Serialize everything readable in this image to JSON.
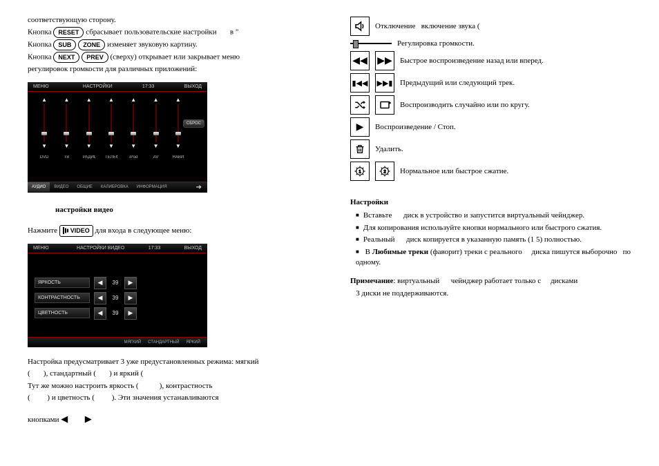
{
  "left": {
    "line1": "соответствующую сторону.",
    "line2_a": "Кнопка",
    "btn_reset": "RESET",
    "line2_b": "сбрасывает пользовательские настройки",
    "line2_c": "в \"",
    "line3_a": "Кнопка",
    "btn_sub": "SUB",
    "btn_zone": "ZONE",
    "line3_b": "изменяет звуковую картину.",
    "line4_a": "Кнопка",
    "btn_next": "NEXT",
    "btn_prev": "PREV",
    "line4_b": "(сверху) открывает или закрывает меню",
    "line5": "регулировок громкости для различных приложений:",
    "screen1": {
      "menu": "МЕНЮ",
      "title": "НАСТРОЙКИ",
      "time": "17:33",
      "exit": "ВЫХОД",
      "sliders": [
        "DVD",
        "ТВ",
        "РАДИО",
        "ТЕЛЕФОН",
        "iPod",
        "AV",
        "НАВИ"
      ],
      "value_base": "0",
      "reset_btn": "СБРОС",
      "tabs": [
        "АУДИО",
        "ВИДЕО",
        "ОБЩИЕ",
        "КАЛИБРОВКА",
        "ИНФОРМАЦИЯ"
      ]
    },
    "video_heading": "настройки видео",
    "video_line1_a": "Нажмите",
    "btn_video": "VIDEO",
    "video_line1_b": "для входа в следующее меню:",
    "screen2": {
      "menu": "МЕНЮ",
      "title": "НАСТРОЙКИ ВИДЕО",
      "time": "17:33",
      "exit": "ВЫХОД",
      "rows": [
        {
          "label": "ЯРКОСТЬ",
          "value": "39"
        },
        {
          "label": "КОНТРАСТНОСТЬ",
          "value": "39"
        },
        {
          "label": "ЦВЕТНОСТЬ",
          "value": "39"
        }
      ],
      "modes": [
        "МЯГКИЙ",
        "СТАНДАРТНЫЙ",
        "ЯРКИЙ"
      ]
    },
    "para2_l1": "Настройка предусматривает  3 уже  предустановленных режима: мягкий",
    "para2_l2": "(       ), стандартный (       ) и яркий (",
    "para2_l3": "Тут  же  можно   настроить  яркость   (           ),   контрастность",
    "para2_l4": "(         )  и  цветность  (         ).  Эти  значения  устанавливаются",
    "para3": "кнопками",
    "arrows": "◀  ▶"
  },
  "right": {
    "rows": [
      {
        "icons": [
          "speaker"
        ],
        "text": "Отключение   включение звука ("
      },
      {
        "icons": [
          "vslider"
        ],
        "text": "Регулировка громкости."
      },
      {
        "icons": [
          "rw",
          "ff"
        ],
        "text": "Быстрое воспроизведение назад или вперед."
      },
      {
        "icons": [
          "prev",
          "next"
        ],
        "text": "Предыдущий или следующий трек."
      },
      {
        "icons": [
          "shuffle",
          "repeat"
        ],
        "text": "Воспроизводить случайно или по кругу."
      },
      {
        "icons": [
          "play"
        ],
        "text": "Воспроизведение / Стоп."
      },
      {
        "icons": [
          "trash"
        ],
        "text": "Удалить."
      },
      {
        "icons": [
          "gear1",
          "gear2"
        ],
        "text": "Нормальное или быстрое сжатие."
      }
    ],
    "settings_heading": "Настройки",
    "bullets": {
      "b1": "Вставьте      диск в устройство и запустится виртуальный чейнджер.",
      "b2": "Для копирования используйте кнопки нормального или быстрого сжатия.",
      "b3": "Реальный      диск копируется в указанную память (1 5) полностью.",
      "b4_a": "В ",
      "b4_b": "Любимые треки",
      "b4_c": " (фаворит) треки с реального     диска пишутся выборочно   по одному."
    },
    "note_a": "Примечание",
    "note_b": ": виртуальный      чейнджер работает только с     дисками",
    "note_c": "   3 диски не поддерживаются."
  }
}
